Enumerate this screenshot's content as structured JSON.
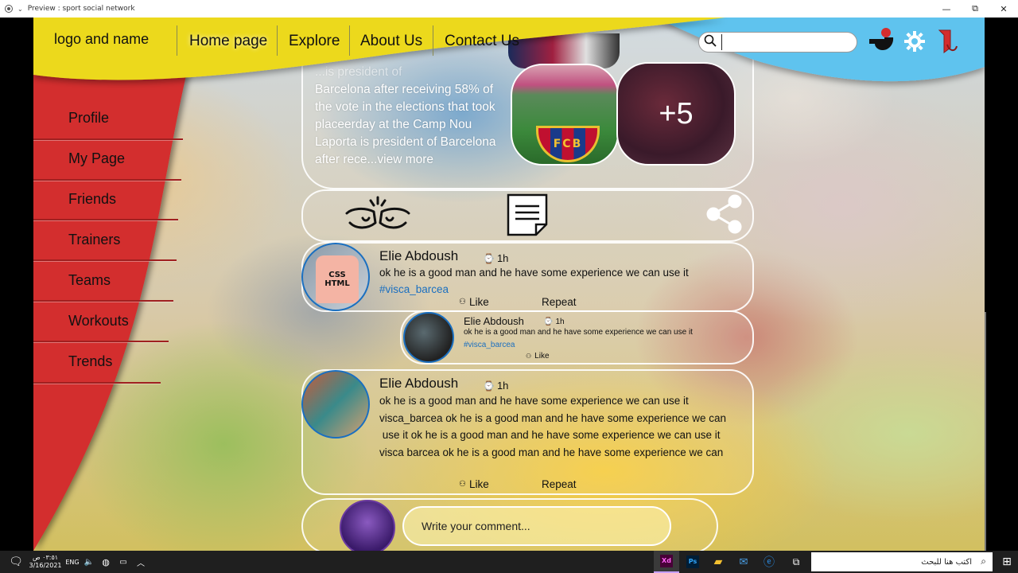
{
  "window": {
    "title": "Preview : sport social network",
    "controls": [
      "—",
      "⧉",
      "✕"
    ]
  },
  "header": {
    "logo": "logo and name",
    "nav": [
      "Home page",
      "Explore",
      "About Us",
      "Contact Us"
    ],
    "active_nav": "Home page",
    "search_placeholder": "",
    "colors": {
      "yellow": "#ecd91e",
      "blue": "#5ec3ee"
    }
  },
  "sidebar": {
    "items": [
      "Profile",
      "My Page",
      "Friends",
      "Trainers",
      "Teams",
      "Workouts",
      "Trends"
    ],
    "color": "#d32d2d"
  },
  "post": {
    "text_partial": "...is president of",
    "text": "Barcelona after receiving 58% of the vote in the elections that took placeerday at the Camp Nou Laporta is president of Barcelona after rece",
    "view_more": "...view more",
    "more_images": "+5",
    "crest_label": "FCB"
  },
  "comments": [
    {
      "author": "Elie Abdoush",
      "time": "1h",
      "text": "ok he is a good man and he have some experience we can use it",
      "tag": "#visca_barcea",
      "like": "Like",
      "repeat": "Repeat",
      "avatar_text": [
        "CSS",
        "HTML"
      ]
    },
    {
      "author": "Elie Abdoush",
      "time": "1h",
      "text": "ok he is a good man and he have some experience we can use it",
      "tag": "#visca_barcea",
      "like": "Like"
    },
    {
      "author": "Elie Abdoush",
      "time": "1h",
      "lines": [
        "ok he is a good man and he have some experience we can use it",
        "visca_barcea ok he is a good man and he have some experience we can",
        " use it ok he is a good man and he have some experience we can use it",
        "visca barcea ok he is a good man and he have some experience we can"
      ],
      "like": "Like",
      "repeat": "Repeat"
    }
  ],
  "composer": {
    "placeholder": "Write your comment..."
  },
  "taskbar": {
    "time": "٠٣:٥١ ص",
    "date": "3/16/2021",
    "lang": "ENG",
    "search_text": "اكتب هنا للبحث",
    "apps": [
      "Xd",
      "Ps",
      "folder",
      "mail",
      "edge",
      "taskview"
    ]
  }
}
